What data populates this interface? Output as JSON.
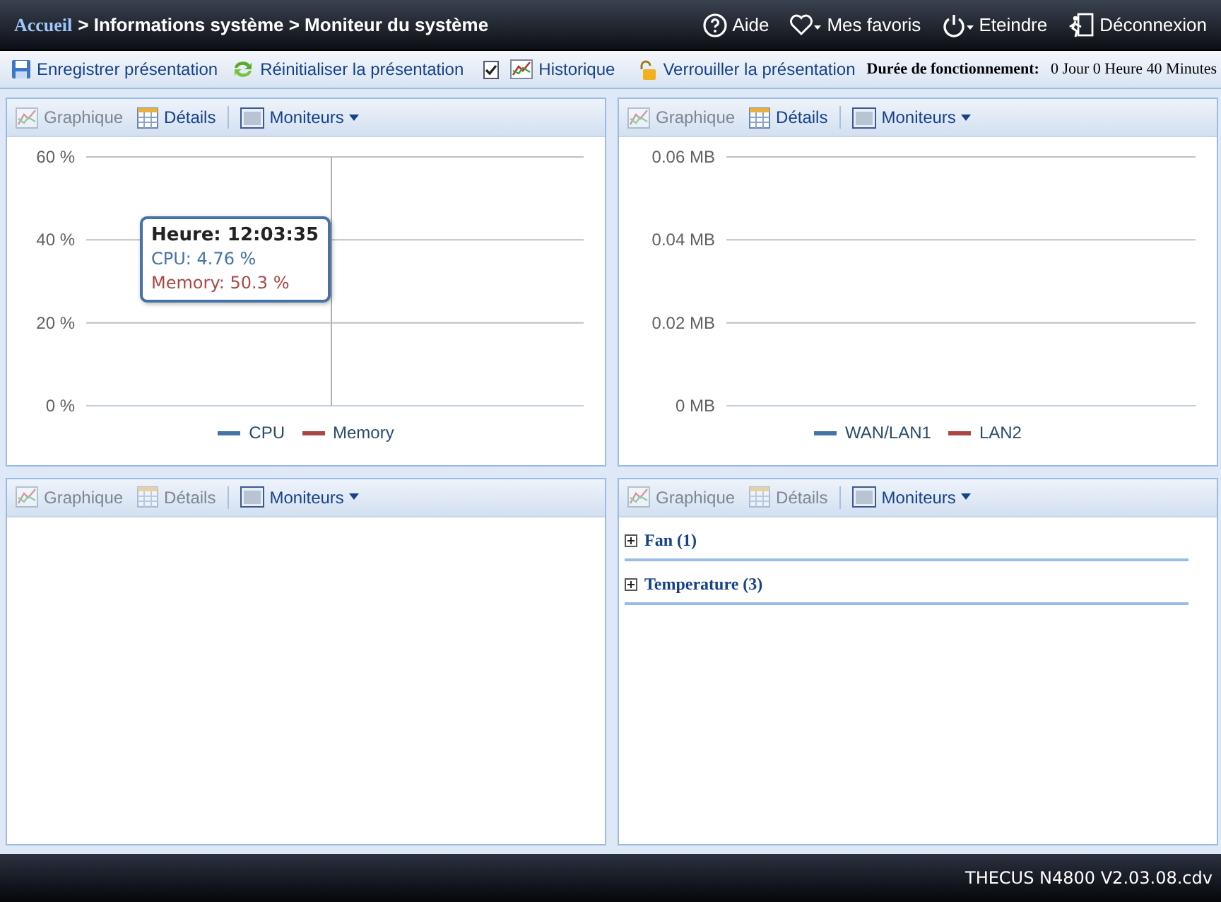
{
  "breadcrumb": {
    "home": "Accueil",
    "path": "> Informations système > Moniteur du système"
  },
  "header_links": [
    {
      "kind": "help",
      "label": "Aide"
    },
    {
      "kind": "favorites",
      "label": "Mes favoris"
    },
    {
      "kind": "power",
      "label": "Eteindre"
    },
    {
      "kind": "logout",
      "label": "Déconnexion"
    }
  ],
  "toolbar": {
    "items": [
      {
        "kind": "save",
        "label": "Enregistrer présentation"
      },
      {
        "kind": "reset",
        "label": "Réinitialiser la présentation"
      },
      {
        "kind": "history",
        "label": "Historique",
        "checked": true
      },
      {
        "kind": "lock",
        "label": "Verrouiller la présentation"
      }
    ],
    "uptime_label": "Durée de fonctionnement:",
    "uptime": "0 Jour 0 Heure 40 Minutes"
  },
  "panels": [
    {
      "kind": "chart",
      "buttons": [
        {
          "kind": "graph",
          "label": "Graphique",
          "disabled": true
        },
        {
          "kind": "details",
          "label": "Détails",
          "disabled": false
        },
        {
          "kind": "monitors",
          "label": "Moniteurs",
          "disabled": false
        }
      ],
      "chart_data": {
        "type": "line",
        "ylim": [
          0,
          60
        ],
        "yticks": [
          {
            "value": 0,
            "label": "0 %"
          },
          {
            "value": 20,
            "label": "20 %"
          },
          {
            "value": 40,
            "label": "40 %"
          },
          {
            "value": 60,
            "label": "60 %"
          }
        ],
        "series": [
          {
            "name": "CPU",
            "color": "#4572a7"
          },
          {
            "name": "Memory",
            "color": "#aa4643"
          }
        ]
      },
      "tooltip": {
        "title": "Heure: 12:03:35",
        "lines": [
          {
            "text": "CPU: 4.76 %",
            "color": "#4572a7"
          },
          {
            "text": "Memory: 50.3 %",
            "color": "#aa4643"
          }
        ]
      }
    },
    {
      "kind": "chart",
      "buttons": [
        {
          "kind": "graph",
          "label": "Graphique",
          "disabled": true
        },
        {
          "kind": "details",
          "label": "Détails",
          "disabled": false
        },
        {
          "kind": "monitors",
          "label": "Moniteurs",
          "disabled": false
        }
      ],
      "chart_data": {
        "type": "line",
        "ylim": [
          0,
          0.06
        ],
        "yticks": [
          {
            "value": 0,
            "label": "0 MB"
          },
          {
            "value": 0.02,
            "label": "0.02 MB"
          },
          {
            "value": 0.04,
            "label": "0.04 MB"
          },
          {
            "value": 0.06,
            "label": "0.06 MB"
          }
        ],
        "series": [
          {
            "name": "WAN/LAN1",
            "color": "#4572a7"
          },
          {
            "name": "LAN2",
            "color": "#aa4643"
          }
        ]
      }
    },
    {
      "kind": "empty",
      "buttons": [
        {
          "kind": "graph",
          "label": "Graphique",
          "disabled": true
        },
        {
          "kind": "details",
          "label": "Détails",
          "disabled": true
        },
        {
          "kind": "monitors",
          "label": "Moniteurs",
          "disabled": false
        }
      ]
    },
    {
      "kind": "groups",
      "buttons": [
        {
          "kind": "graph",
          "label": "Graphique",
          "disabled": true
        },
        {
          "kind": "details",
          "label": "Détails",
          "disabled": true
        },
        {
          "kind": "monitors",
          "label": "Moniteurs",
          "disabled": false
        }
      ],
      "groups": [
        {
          "label": "Fan (1)",
          "expanded": false
        },
        {
          "label": "Temperature (3)",
          "expanded": false
        }
      ]
    }
  ],
  "footer": "THECUS N4800 V2.03.08.cdv"
}
